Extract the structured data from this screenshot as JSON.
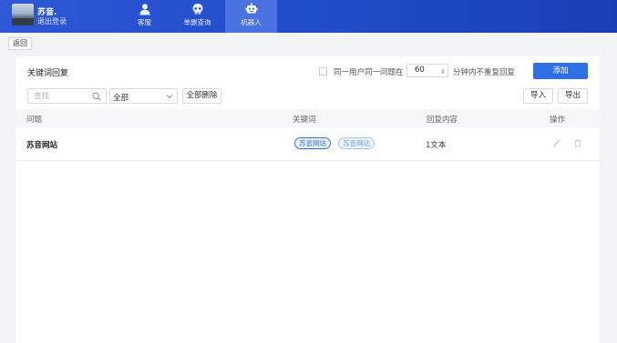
{
  "header": {
    "user_name": "苏音.",
    "logout_label": "退出登录",
    "tabs": [
      {
        "label": "客服",
        "icon": "user-icon",
        "active": false
      },
      {
        "label": "单删查询",
        "icon": "skull-icon",
        "active": false
      },
      {
        "label": "机器人",
        "icon": "robot-icon",
        "active": true
      }
    ]
  },
  "back_label": "返回",
  "panel": {
    "title": "关键词回复",
    "dedupe_prefix": "同一用户同一问题在",
    "dedupe_minutes": "60",
    "dedupe_suffix": "分钟内不重复回复",
    "add_label": "添加"
  },
  "toolbar": {
    "search_placeholder": "查找",
    "filter_value": "全部",
    "delete_all_label": "全部删除",
    "import_label": "导入",
    "export_label": "导出"
  },
  "table": {
    "columns": [
      "问题",
      "关键词",
      "回复内容",
      "操作"
    ],
    "rows": [
      {
        "question": "苏音网站",
        "keywords": [
          "苏音网站",
          "苏音网站"
        ],
        "reply": "1文本"
      }
    ]
  },
  "colors": {
    "topbar": "#1f4cc8",
    "accent": "#2f6fe6",
    "active_tab": "#4a72e0"
  }
}
